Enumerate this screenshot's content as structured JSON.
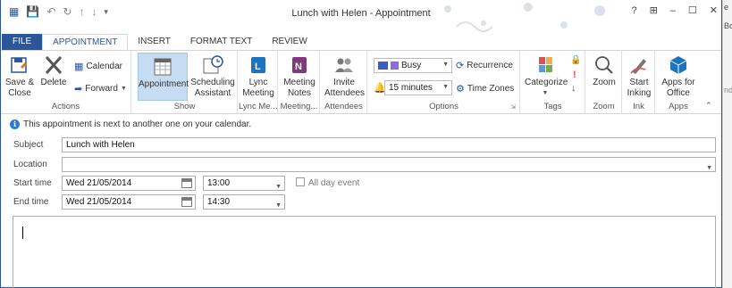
{
  "window": {
    "title": "Lunch with Helen - Appointment",
    "controls": {
      "help": "?",
      "restore_ribbon": "⊞",
      "minimize": "–",
      "maximize": "☐",
      "close": "✕"
    }
  },
  "background_strip": {
    "t1": "e",
    "t2": "Boo",
    "t3": "nda"
  },
  "tabs": [
    "FILE",
    "APPOINTMENT",
    "INSERT",
    "FORMAT TEXT",
    "REVIEW"
  ],
  "ribbon": {
    "actions": {
      "label": "Actions",
      "save_close": "Save & Close",
      "delete": "Delete",
      "calendar": "Calendar",
      "forward": "Forward"
    },
    "show": {
      "label": "Show",
      "appointment": "Appointment",
      "scheduling_assistant": "Scheduling Assistant"
    },
    "lync": {
      "label": "Lync Me...",
      "lync_meeting": "Lync Meeting"
    },
    "meeting_notes": {
      "label": "Meeting...",
      "meeting_notes": "Meeting Notes"
    },
    "attendees": {
      "label": "Attendees",
      "invite_attendees": "Invite Attendees"
    },
    "options": {
      "label": "Options",
      "show_as": "Busy",
      "reminder": "15 minutes",
      "recurrence": "Recurrence",
      "time_zones": "Time Zones"
    },
    "tags": {
      "label": "Tags",
      "categorize": "Categorize"
    },
    "zoom": {
      "label": "Zoom",
      "zoom": "Zoom"
    },
    "ink": {
      "label": "Ink",
      "start_inking": "Start Inking"
    },
    "apps": {
      "label": "Apps",
      "apps_for_office": "Apps for Office"
    }
  },
  "info_message": "This appointment is next to another one on your calendar.",
  "form": {
    "subject_label": "Subject",
    "subject_value": "Lunch with Helen",
    "location_label": "Location",
    "location_value": "",
    "start_label": "Start time",
    "start_date": "Wed 21/05/2014",
    "start_time": "13:00",
    "all_day_label": "All day event",
    "end_label": "End time",
    "end_date": "Wed 21/05/2014",
    "end_time": "14:30"
  },
  "colors": {
    "accent": "#2b579a",
    "selected": "#c5dcf2",
    "busy_purple": "#8b6fd6"
  }
}
